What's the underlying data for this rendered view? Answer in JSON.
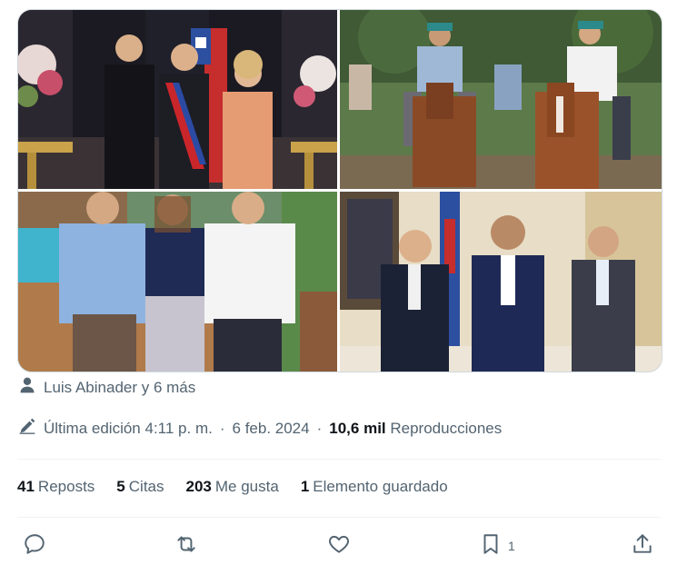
{
  "photos": [
    {
      "name": "photo-ceremony"
    },
    {
      "name": "photo-horseback"
    },
    {
      "name": "photo-terrace"
    },
    {
      "name": "photo-office"
    }
  ],
  "tagged": {
    "text": "Luis Abinader y 6 más",
    "icon": "person-icon"
  },
  "edited": {
    "label": "Última edición",
    "time": "4:11 p. m.",
    "sep1": "·",
    "date": "6 feb. 2024",
    "sep2": "·",
    "views_count": "10,6 mil",
    "views_label": "Reproducciones",
    "icon": "pencil-icon"
  },
  "stats": [
    {
      "count": "41",
      "label": "Reposts"
    },
    {
      "count": "5",
      "label": "Citas"
    },
    {
      "count": "203",
      "label": "Me gusta"
    },
    {
      "count": "1",
      "label": "Elemento guardado"
    }
  ],
  "actions": {
    "reply_icon": "reply-icon",
    "repost_icon": "repost-icon",
    "like_icon": "heart-icon",
    "bookmark_icon": "bookmark-icon",
    "bookmark_count": "1",
    "share_icon": "share-icon"
  },
  "colors": {
    "text": "#0f1419",
    "muted": "#536471",
    "border": "#cfd9de"
  }
}
